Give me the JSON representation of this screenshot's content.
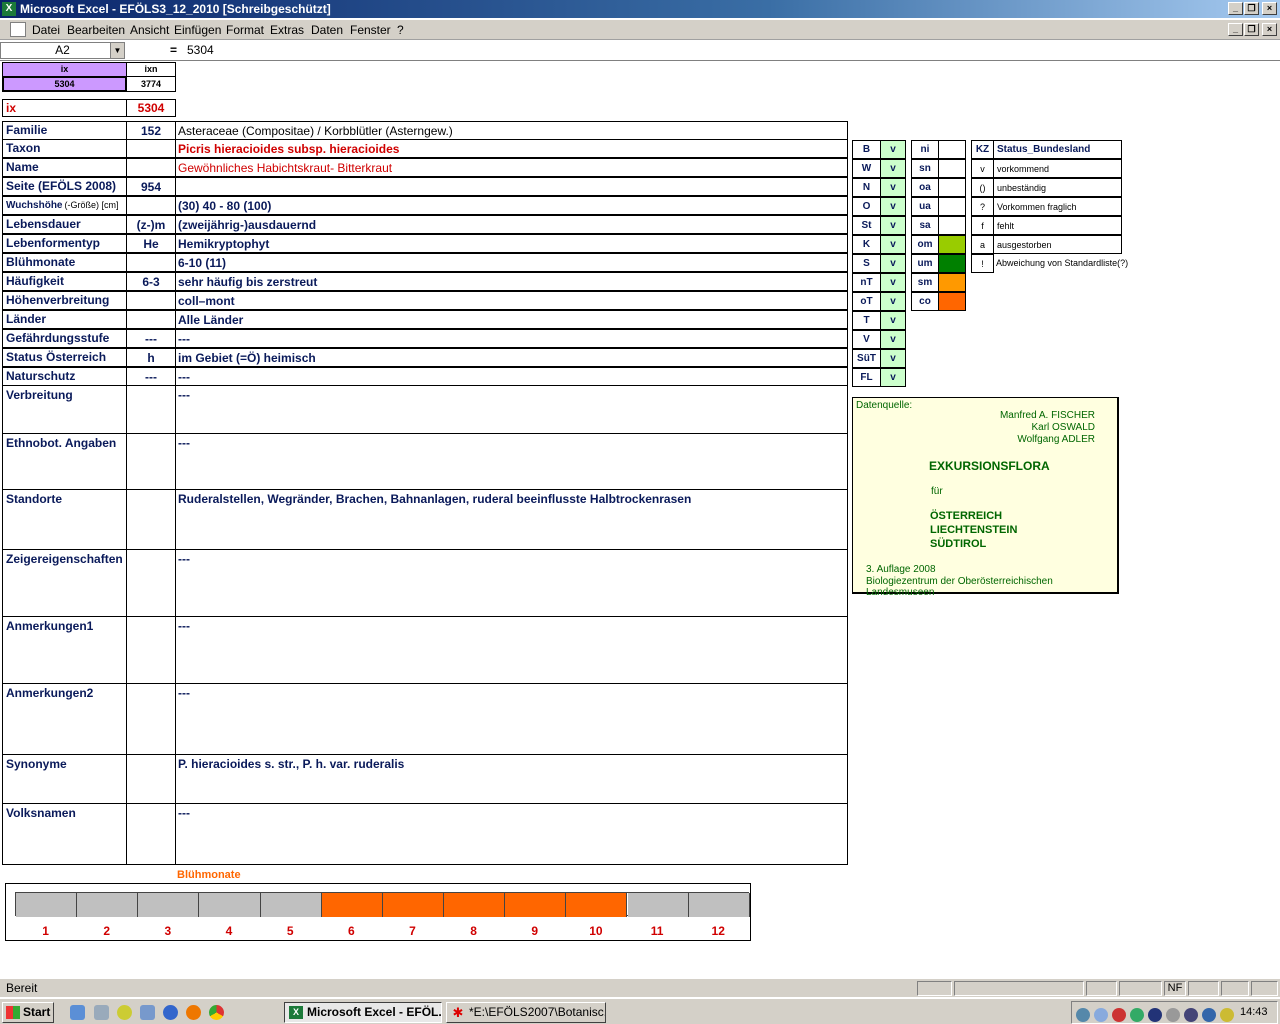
{
  "window": {
    "title": "Microsoft Excel - EFÖLS3_12_2010  [Schreibgeschützt]"
  },
  "menu": [
    "Datei",
    "Bearbeiten",
    "Ansicht",
    "Einfügen",
    "Format",
    "Extras",
    "Daten",
    "Fenster",
    "?"
  ],
  "formula": {
    "cell_ref": "A2",
    "equals": "=",
    "value": "5304"
  },
  "top_cells": {
    "ix_header": "ix",
    "ixn_header": "ixn",
    "ix_value": "5304",
    "ixn_value": "3774",
    "ix_label": "ix",
    "ix_big": "5304"
  },
  "rows": [
    {
      "label": "Familie",
      "code": "152",
      "value": "Asteraceae (Compositae)  /  Korbblütler (Asterngew.)"
    },
    {
      "label": "Taxon",
      "code": "",
      "value": "Picris hieracioides subsp. hieracioides"
    },
    {
      "label": "Name",
      "code": "",
      "value": "Gewöhnliches Habichtskraut- Bitterkraut"
    },
    {
      "label": "Seite (EFÖLS 2008)",
      "code": "954",
      "value": ""
    },
    {
      "label": "Wuchshöhe",
      "label_small": "(-Größe) [cm]",
      "code": "",
      "value": "(30) 40 - 80 (100)"
    },
    {
      "label": "Lebensdauer",
      "code": "(z-)m",
      "value": "(zweijährig-)ausdauernd"
    },
    {
      "label": "Lebenformentyp",
      "code": "He",
      "value": "Hemikryptophyt"
    },
    {
      "label": "Blühmonate",
      "code": "",
      "value": "6-10 (11)"
    },
    {
      "label": "Häufigkeit",
      "code": "6-3",
      "value": "sehr häufig bis zerstreut"
    },
    {
      "label": "Höhenverbreitung",
      "code": "",
      "value": "coll–mont"
    },
    {
      "label": "Länder",
      "code": "",
      "value": "Alle Länder"
    },
    {
      "label": "Gefährdungsstufe",
      "code": "---",
      "value": "---"
    },
    {
      "label": "Status Österreich",
      "code": "h",
      "value": "im Gebiet (=Ö) heimisch"
    },
    {
      "label": "Naturschutz",
      "code": "---",
      "value": "---"
    }
  ],
  "tall_rows": [
    {
      "label": "Verbreitung",
      "value": "---"
    },
    {
      "label": "Ethnobot. Angaben",
      "value": "---"
    },
    {
      "label": "Standorte",
      "value": "Ruderalstellen, Wegränder, Brachen, Bahnanlagen, ruderal beeinflusste Halbtrockenrasen"
    },
    {
      "label": "Zeigereigenschaften",
      "value": "---"
    },
    {
      "label": "Anmerkungen1",
      "value": "---"
    },
    {
      "label": "Anmerkungen2",
      "value": "---"
    },
    {
      "label": "Synonyme",
      "value": "P. hieracioides s. str., P. h. var. ruderalis"
    },
    {
      "label": "Volksnamen",
      "value": "---"
    }
  ],
  "regions": [
    {
      "code": "B",
      "status": "v"
    },
    {
      "code": "W",
      "status": "v"
    },
    {
      "code": "N",
      "status": "v"
    },
    {
      "code": "O",
      "status": "v"
    },
    {
      "code": "St",
      "status": "v"
    },
    {
      "code": "K",
      "status": "v"
    },
    {
      "code": "S",
      "status": "v"
    },
    {
      "code": "nT",
      "status": "v"
    },
    {
      "code": "oT",
      "status": "v"
    },
    {
      "code": "T",
      "status": "v"
    },
    {
      "code": "V",
      "status": "v"
    },
    {
      "code": "SüT",
      "status": "v"
    },
    {
      "code": "FL",
      "status": "v"
    }
  ],
  "altitude": [
    {
      "code": "ni",
      "color": ""
    },
    {
      "code": "sn",
      "color": ""
    },
    {
      "code": "oa",
      "color": ""
    },
    {
      "code": "ua",
      "color": ""
    },
    {
      "code": "sa",
      "color": ""
    },
    {
      "code": "om",
      "color": "#99cc00"
    },
    {
      "code": "um",
      "color": "#008000"
    },
    {
      "code": "sm",
      "color": "#ff9900"
    },
    {
      "code": "co",
      "color": "#ff6600"
    }
  ],
  "status_legend": {
    "header_kz": "KZ",
    "header_label": "Status_Bundesland",
    "items": [
      {
        "kz": "v",
        "label": "vorkommend"
      },
      {
        "kz": "()",
        "label": "unbeständig"
      },
      {
        "kz": "?",
        "label": "Vorkommen fraglich"
      },
      {
        "kz": "f",
        "label": "fehlt"
      },
      {
        "kz": "a",
        "label": "ausgestorben"
      },
      {
        "kz": "!",
        "label": "Abweichung von Standardliste(?)"
      }
    ]
  },
  "source_box": {
    "heading": "Datenquelle:",
    "authors": [
      "Manfred A. FISCHER",
      "Karl OSWALD",
      "Wolfgang ADLER"
    ],
    "title": "EXKURSIONSFLORA",
    "fuer": "für",
    "countries": [
      "ÖSTERREICH",
      "LIECHTENSTEIN",
      "SÜDTIROL"
    ],
    "edition": "3. Auflage 2008",
    "publisher": "Biologiezentrum der Oberösterreichischen Landesmuseen"
  },
  "bloom": {
    "title": "Blühmonate",
    "months": [
      "1",
      "2",
      "3",
      "4",
      "5",
      "6",
      "7",
      "8",
      "9",
      "10",
      "11",
      "12"
    ],
    "active": [
      false,
      false,
      false,
      false,
      false,
      true,
      true,
      true,
      true,
      true,
      false,
      false
    ],
    "active_color": "#ff6600",
    "inactive_color": "#c0c0c0"
  },
  "statusbar": {
    "text": "Bereit",
    "nf": "NF"
  },
  "taskbar": {
    "start": "Start",
    "tasks": [
      "Microsoft Excel - EFÖL...",
      "*E:\\EFÖLS2007\\Botanisc..."
    ],
    "time": "14:43"
  }
}
